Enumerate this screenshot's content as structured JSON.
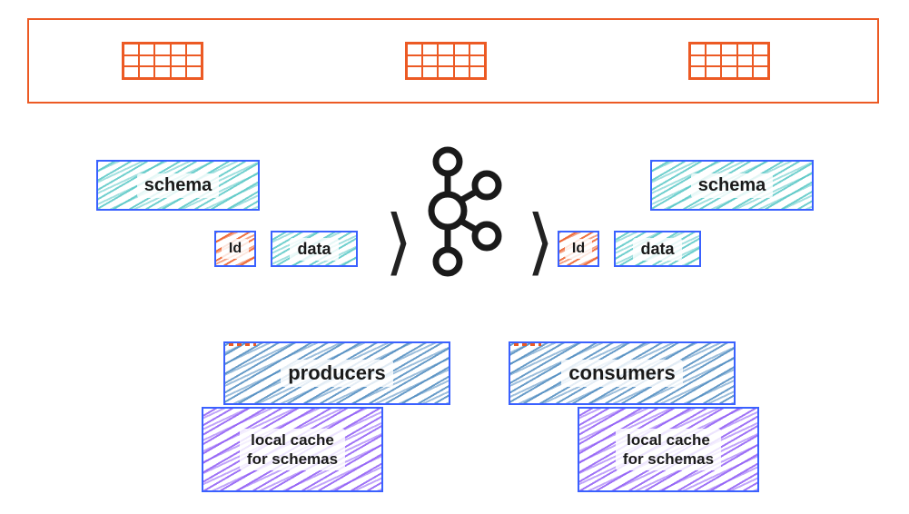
{
  "labels": {
    "schema": "schema",
    "id": "Id",
    "data": "data",
    "producers": "producers",
    "consumers": "consumers",
    "local_cache": "local cache\nfor schemas"
  },
  "colors": {
    "orange": "#ec5a24",
    "teal": "#57c7c5",
    "blue_border": "#3a61ff",
    "purple": "#8f5cf5",
    "steel_blue": "#4e8bbf",
    "dark": "#1a1a1a"
  },
  "diagram": {
    "top_row_grids": 3,
    "flow": [
      "schema",
      "id+data",
      "kafka",
      "id+data",
      "schema"
    ],
    "bottom_left": [
      "producers",
      "local_cache"
    ],
    "bottom_right": [
      "consumers",
      "local_cache"
    ]
  }
}
